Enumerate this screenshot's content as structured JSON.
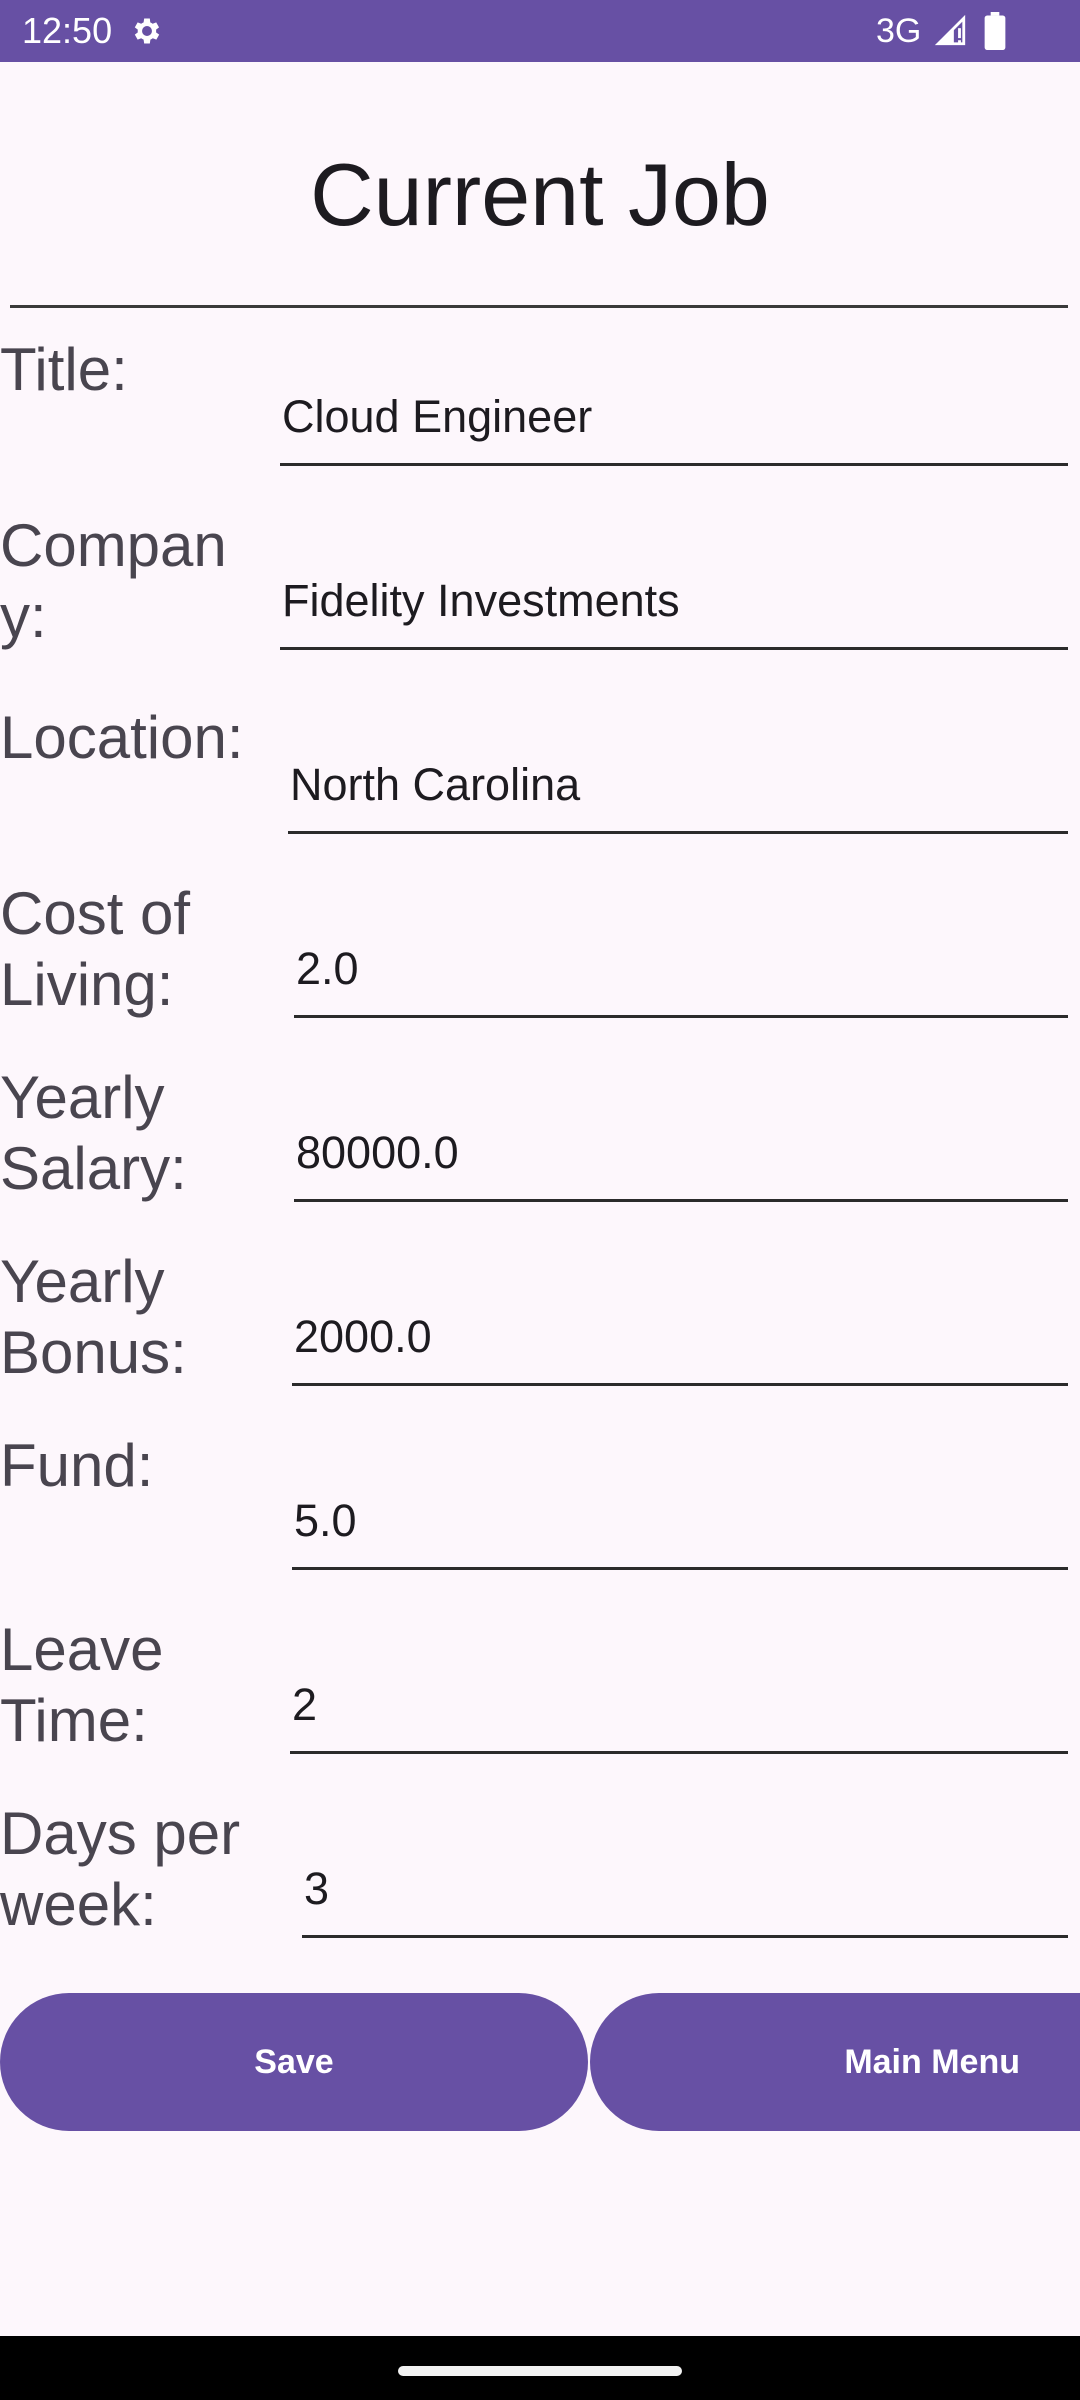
{
  "status_bar": {
    "time": "12:50",
    "network": "3G",
    "icons": [
      "gear-icon",
      "signal-icon",
      "battery-icon"
    ],
    "color": "#6750a4"
  },
  "page": {
    "title": "Current Job"
  },
  "form": {
    "fields": [
      {
        "label": "Title:",
        "value": "Cloud Engineer"
      },
      {
        "label": "Company:",
        "value": "Fidelity Investments"
      },
      {
        "label": "Location:",
        "value": "North Carolina"
      },
      {
        "label": "Cost of Living:",
        "value": "2.0"
      },
      {
        "label": "Yearly Salary:",
        "value": "80000.0"
      },
      {
        "label": "Yearly Bonus:",
        "value": "2000.0"
      },
      {
        "label": "Fund:",
        "value": "5.0"
      },
      {
        "label": "Leave Time:",
        "value": "2"
      },
      {
        "label": "Days per week:",
        "value": "3"
      }
    ]
  },
  "buttons": {
    "save": "Save",
    "main_menu": "Main Menu"
  },
  "theme": {
    "accent": "#6750a4",
    "background": "#fdf7fc"
  }
}
